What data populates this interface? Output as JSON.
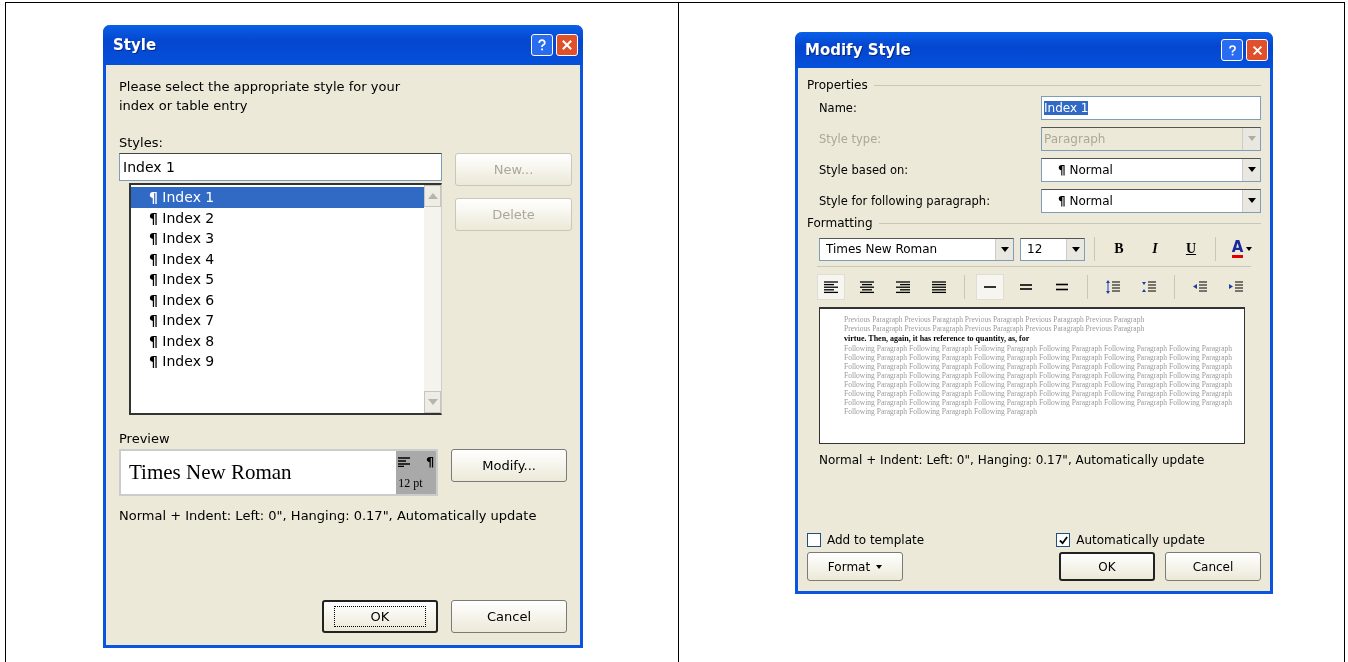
{
  "style_dialog": {
    "title": "Style",
    "intro": "Please select the appropriate style for your index or table entry",
    "styles_label": "Styles:",
    "style_name": "Index 1",
    "styles": [
      {
        "mark": "¶",
        "label": "Index 1",
        "selected": true
      },
      {
        "mark": "¶",
        "label": "Index 2",
        "selected": false
      },
      {
        "mark": "¶",
        "label": "Index 3",
        "selected": false
      },
      {
        "mark": "¶",
        "label": "Index 4",
        "selected": false
      },
      {
        "mark": "¶",
        "label": "Index 5",
        "selected": false
      },
      {
        "mark": "¶",
        "label": "Index 6",
        "selected": false
      },
      {
        "mark": "¶",
        "label": "Index 7",
        "selected": false
      },
      {
        "mark": "¶",
        "label": "Index 8",
        "selected": false
      },
      {
        "mark": "¶",
        "label": "Index 9",
        "selected": false
      }
    ],
    "side_buttons": [
      {
        "label": "New...",
        "disabled": true
      },
      {
        "label": "Delete",
        "disabled": true
      }
    ],
    "preview_label": "Preview",
    "preview_font": "Times New Roman",
    "preview_mark": "¶",
    "preview_size": "12 pt",
    "modify_button": "Modify...",
    "description": "Normal + Indent: Left:  0\", Hanging:  0.17\", Automatically update",
    "buttons": [
      {
        "label": "OK",
        "default": true
      },
      {
        "label": "Cancel",
        "default": false
      }
    ]
  },
  "modify_dialog": {
    "title": "Modify Style",
    "properties_label": "Properties",
    "fields": [
      {
        "label": "Name:",
        "kind": "text",
        "value": "Index 1",
        "disabled": false
      },
      {
        "label": "Style type:",
        "kind": "combo",
        "value": "Paragraph",
        "disabled": true
      },
      {
        "label": "Style based on:",
        "kind": "combo",
        "mark": "¶",
        "value": "Normal",
        "disabled": false
      },
      {
        "label": "Style for following paragraph:",
        "kind": "combo",
        "mark": "¶",
        "value": "Normal",
        "disabled": false
      }
    ],
    "formatting_label": "Formatting",
    "font": "Times New Roman",
    "size": "12",
    "bold": "B",
    "italic": "I",
    "underline": "U",
    "font_color": "A",
    "align_buttons": [
      {
        "kind": "left",
        "selected": true
      },
      {
        "kind": "center",
        "selected": false
      },
      {
        "kind": "right",
        "selected": false
      },
      {
        "kind": "justify",
        "selected": false
      }
    ],
    "spacing_buttons": [
      {
        "kind": "single",
        "selected": true
      },
      {
        "kind": "onehalf",
        "selected": false
      },
      {
        "kind": "double",
        "selected": false
      }
    ],
    "preview_lines": [
      {
        "kind": "muted",
        "text": "Previous Paragraph Previous Paragraph Previous Paragraph Previous Paragraph Previous Paragraph"
      },
      {
        "kind": "muted",
        "text": "Previous Paragraph Previous Paragraph Previous Paragraph Previous Paragraph Previous Paragraph"
      },
      {
        "kind": "main",
        "text": "virtue. Then, again, it has reference to quantity, as, for"
      },
      {
        "kind": "muted",
        "text": "Following Paragraph Following Paragraph Following Paragraph Following Paragraph Following Paragraph Following Paragraph"
      },
      {
        "kind": "muted",
        "text": "Following Paragraph Following Paragraph Following Paragraph Following Paragraph Following Paragraph Following Paragraph"
      },
      {
        "kind": "muted",
        "text": "Following Paragraph Following Paragraph Following Paragraph Following Paragraph Following Paragraph Following Paragraph"
      },
      {
        "kind": "muted",
        "text": "Following Paragraph Following Paragraph Following Paragraph Following Paragraph Following Paragraph Following Paragraph"
      },
      {
        "kind": "muted",
        "text": "Following Paragraph Following Paragraph Following Paragraph Following Paragraph Following Paragraph Following Paragraph"
      },
      {
        "kind": "muted",
        "text": "Following Paragraph Following Paragraph Following Paragraph Following Paragraph Following Paragraph Following Paragraph"
      },
      {
        "kind": "muted",
        "text": "Following Paragraph Following Paragraph Following Paragraph Following Paragraph Following Paragraph Following Paragraph"
      },
      {
        "kind": "muted",
        "text": "Following Paragraph Following Paragraph Following Paragraph"
      }
    ],
    "description": "Normal + Indent: Left:  0\", Hanging:  0.17\", Automatically update",
    "checkboxes": [
      {
        "label": "Add to template",
        "checked": false
      },
      {
        "label": "Automatically update",
        "checked": true
      }
    ],
    "format_button": "Format",
    "buttons": [
      {
        "label": "OK",
        "default": true
      },
      {
        "label": "Cancel",
        "default": false
      }
    ]
  }
}
